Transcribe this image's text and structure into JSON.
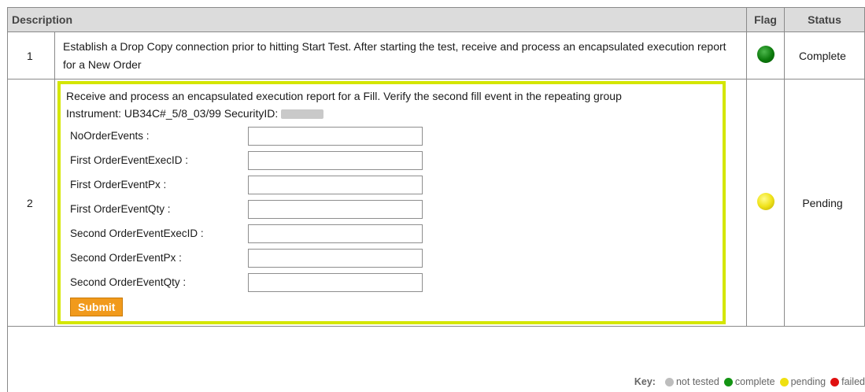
{
  "table": {
    "headers": {
      "description": "Description",
      "flag": "Flag",
      "status": "Status"
    },
    "rows": [
      {
        "num": "1",
        "description": "Establish a Drop Copy connection prior to hitting Start Test. After starting the test, receive and process an encapsulated execution report for a New Order",
        "flag_color": "green",
        "status": "Complete"
      },
      {
        "num": "2",
        "description": "Receive and process an encapsulated execution report for a Fill. Verify the second fill event in the repeating group",
        "instrument_label": "Instrument: UB34C#_5/8_03/99 SecurityID:",
        "flag_color": "yellow",
        "status": "Pending"
      }
    ]
  },
  "form": {
    "fields": [
      {
        "label": "NoOrderEvents :",
        "value": ""
      },
      {
        "label": "First OrderEventExecID :",
        "value": ""
      },
      {
        "label": "First OrderEventPx :",
        "value": ""
      },
      {
        "label": "First OrderEventQty :",
        "value": ""
      },
      {
        "label": "Second OrderEventExecID :",
        "value": ""
      },
      {
        "label": "Second OrderEventPx :",
        "value": ""
      },
      {
        "label": "Second OrderEventQty :",
        "value": ""
      }
    ],
    "submit_label": "Submit"
  },
  "key": {
    "label": "Key:",
    "items": [
      {
        "label": "not tested",
        "color": "#bdbdbd"
      },
      {
        "label": "complete",
        "color": "#139413"
      },
      {
        "label": "pending",
        "color": "#efe010"
      },
      {
        "label": "failed",
        "color": "#e01010"
      }
    ]
  }
}
